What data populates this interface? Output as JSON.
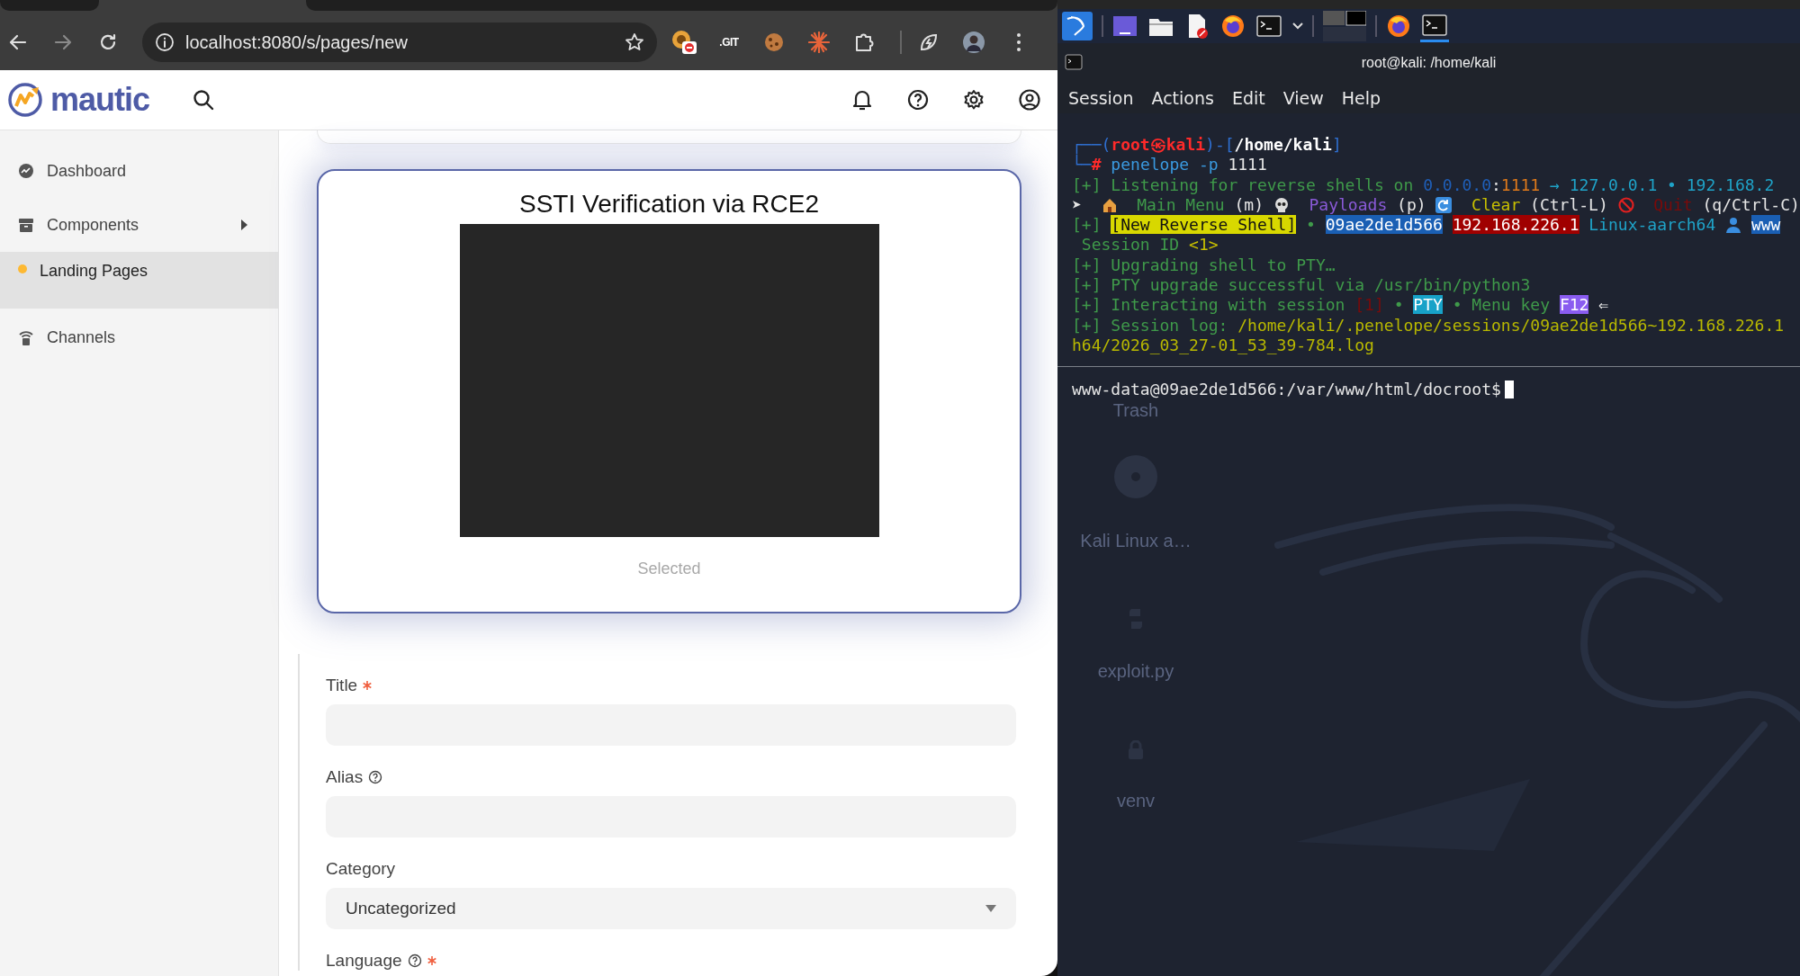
{
  "browser": {
    "url": "localhost:8080/s/pages/new",
    "forward_disabled": true,
    "extension_label": ".GIT"
  },
  "app": {
    "logo_text": "mautic",
    "sidebar": [
      {
        "label": "Dashboard",
        "selected": false,
        "has_submenu": false
      },
      {
        "label": "Components",
        "selected": false,
        "has_submenu": true
      },
      {
        "label": "Landing Pages",
        "selected": true,
        "has_submenu": false
      },
      {
        "label": "Channels",
        "selected": false,
        "has_submenu": false
      }
    ],
    "card": {
      "title": "SSTI Verification via RCE2",
      "status": "Selected"
    },
    "form": {
      "fields": [
        {
          "label": "Title",
          "required": true,
          "help": false,
          "kind": "text"
        },
        {
          "label": "Alias",
          "required": false,
          "help": true,
          "kind": "text"
        },
        {
          "label": "Category",
          "required": false,
          "help": false,
          "kind": "select",
          "value": "Uncategorized"
        },
        {
          "label": "Language",
          "required": true,
          "help": true
        }
      ]
    }
  },
  "terminal": {
    "title": "root@kali: /home/kali",
    "menu": [
      "Session",
      "Actions",
      "Edit",
      "View",
      "Help"
    ],
    "desktop_icons": [
      {
        "label": "Trash"
      },
      {
        "label": "Kali Linux a…"
      },
      {
        "label": "exploit.py"
      },
      {
        "label": "venv"
      }
    ],
    "lines": [
      {
        "segments": [
          {
            "text": "┌──(",
            "color": "#2f6fd0"
          },
          {
            "text": "root㉿kali",
            "color": "#ff2a2a",
            "bold": true
          },
          {
            "text": ")-[",
            "color": "#2f6fd0"
          },
          {
            "text": "/home/kali",
            "color": "#ffffff",
            "bold": true
          },
          {
            "text": "]",
            "color": "#2f6fd0"
          }
        ]
      },
      {
        "segments": [
          {
            "text": "└─",
            "color": "#2f6fd0"
          },
          {
            "text": "#",
            "color": "#ff2a2a",
            "bold": true
          },
          {
            "text": " penelope -p",
            "color": "#3a9ae0"
          },
          {
            "text": " 1111",
            "color": "#e6e6e6"
          }
        ]
      },
      {
        "segments": [
          {
            "text": "[+] Listening for reverse shells on ",
            "color": "#3f9a4a"
          },
          {
            "text": "0.0.0.0",
            "color": "#1f5fb8"
          },
          {
            "text": ":",
            "color": "#e6e6e6"
          },
          {
            "text": "1111",
            "color": "#e07a1a"
          },
          {
            "text": " → 127.0.0.1 • 192.168.2",
            "color": "#1fa3c8"
          }
        ]
      },
      {
        "segments": [
          {
            "text": "➤  ",
            "color": "#e6e6e6"
          },
          {
            "kind": "icon"
          },
          {
            "text": " Main Menu ",
            "color": "#3f9a4a"
          },
          {
            "text": "(m) ",
            "color": "#e6e6e6"
          },
          {
            "kind": "icon"
          },
          {
            "text": " Payloads ",
            "color": "#8a5ad8"
          },
          {
            "text": "(p) ",
            "color": "#e6e6e6"
          },
          {
            "kind": "icon"
          },
          {
            "text": " Clear ",
            "color": "#c8c000"
          },
          {
            "text": "(Ctrl-L) ",
            "color": "#e6e6e6"
          },
          {
            "kind": "icon"
          },
          {
            "text": " Quit ",
            "color": "#7a0a0a"
          },
          {
            "text": "(q/Ctrl-C)",
            "color": "#e6e6e6"
          }
        ]
      },
      {
        "segments": [
          {
            "text": "[+] ",
            "color": "#3f9a4a"
          },
          {
            "kind": "highlight",
            "text": "[New Reverse Shell]",
            "color": "#d8d800"
          },
          {
            "text": " • ",
            "color": "#3f9a4a"
          },
          {
            "kind": "highlight",
            "text": "09ae2de1d566",
            "color": "#1a5fb4"
          },
          {
            "kind": "highlight",
            "text": "192.168.226.1",
            "color": "#a00000"
          },
          {
            "text": " Linux-aarch64 ",
            "color": "#1fa3c8"
          },
          {
            "kind": "icon"
          },
          {
            "kind": "highlight",
            "text": "www",
            "color": "#1a5fb4"
          }
        ]
      },
      {
        "segments": [
          {
            "text": " Session ID ",
            "color": "#3f9a4a"
          },
          {
            "text": "<1>",
            "color": "#c8c000"
          }
        ]
      },
      {
        "segments": [
          {
            "text": "[+] Upgrading shell to PTY…",
            "color": "#3f9a4a"
          }
        ]
      },
      {
        "segments": [
          {
            "text": "[+] PTY upgrade successful via /usr/bin/python3",
            "color": "#3f9a4a"
          }
        ]
      },
      {
        "segments": [
          {
            "text": "[+] Interacting with session ",
            "color": "#3f9a4a"
          },
          {
            "text": "[1]",
            "color": "#7a0a0a"
          },
          {
            "text": " • ",
            "color": "#3f9a4a"
          },
          {
            "kind": "highlight",
            "text": "PTY",
            "color": "#17a2c8"
          },
          {
            "text": " • Menu key ",
            "color": "#3f9a4a"
          },
          {
            "kind": "highlight",
            "text": "F12",
            "color": "#8a5cf0"
          },
          {
            "text": " ⇐",
            "color": "#e6e6e6"
          }
        ]
      },
      {
        "segments": [
          {
            "text": "[+] Session log: ",
            "color": "#3f9a4a"
          },
          {
            "text": "/home/kali/.penelope/sessions/09ae2de1d566~192.168.226.1",
            "color": "#b8b800"
          }
        ]
      },
      {
        "segments": [
          {
            "text": "h64/2026_03_27-01_53_39-784.log",
            "color": "#b8b800"
          }
        ]
      }
    ],
    "prompt": "www-data@09ae2de1d566:/var/www/html/docroot$"
  }
}
